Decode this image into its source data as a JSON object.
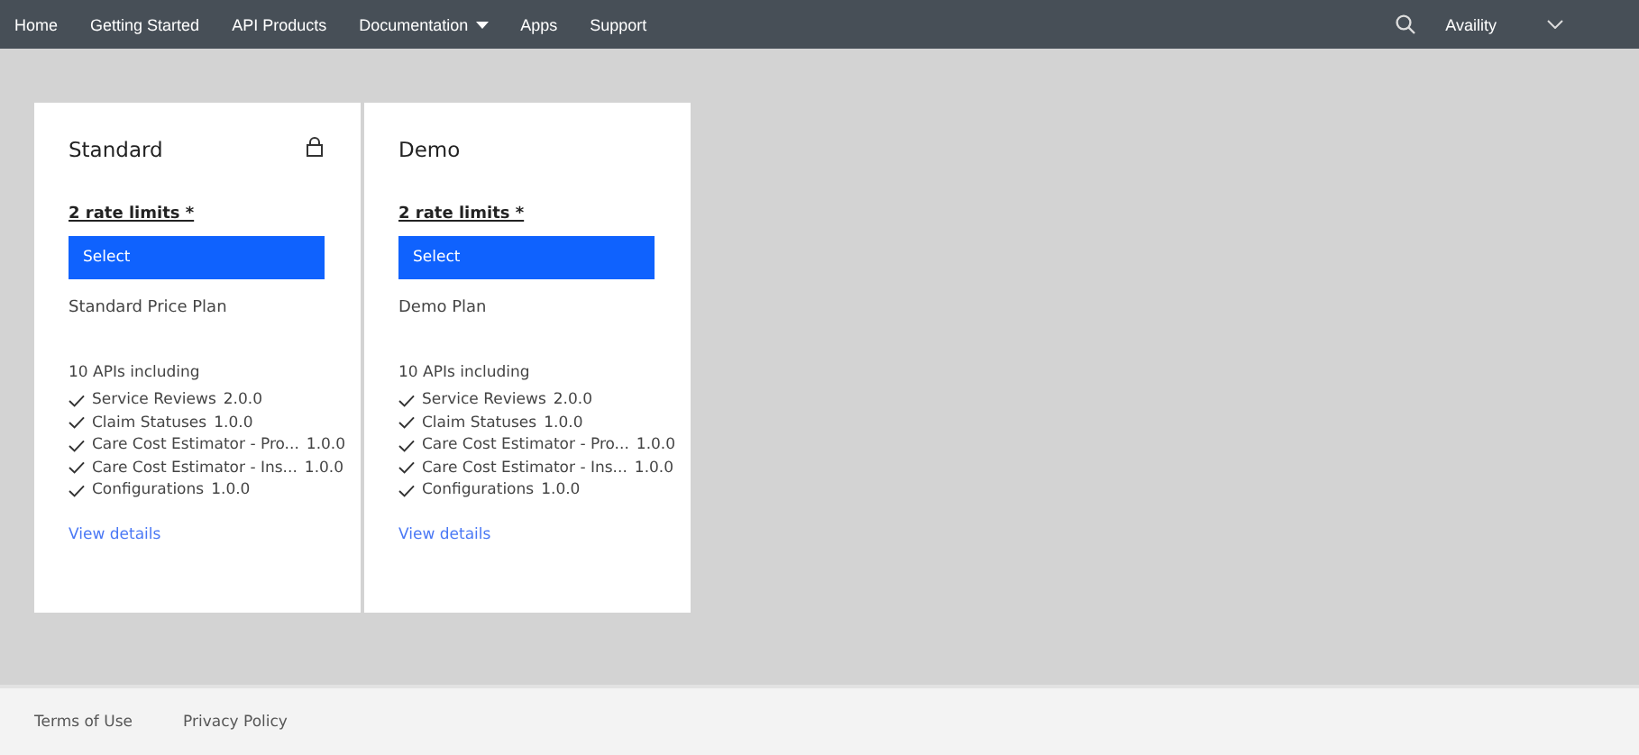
{
  "nav": {
    "items": [
      {
        "label": "Home",
        "dropdown": false
      },
      {
        "label": "Getting Started",
        "dropdown": false
      },
      {
        "label": "API Products",
        "dropdown": false
      },
      {
        "label": "Documentation",
        "dropdown": true
      },
      {
        "label": "Apps",
        "dropdown": false
      },
      {
        "label": "Support",
        "dropdown": false
      }
    ],
    "account": "Availity"
  },
  "plans": [
    {
      "title": "Standard",
      "locked": true,
      "rate_limits": "2 rate limits *",
      "button": "Select",
      "description": "Standard Price Plan",
      "apis_heading": "10 APIs including",
      "apis": [
        {
          "name": "Service Reviews",
          "version": "2.0.0"
        },
        {
          "name": "Claim Statuses",
          "version": "1.0.0"
        },
        {
          "name": "Care Cost Estimator - Pro...",
          "version": "1.0.0"
        },
        {
          "name": "Care Cost Estimator - Ins...",
          "version": "1.0.0"
        },
        {
          "name": "Configurations",
          "version": "1.0.0"
        }
      ],
      "link": "View details"
    },
    {
      "title": "Demo",
      "locked": false,
      "rate_limits": "2 rate limits *",
      "button": "Select",
      "description": "Demo Plan",
      "apis_heading": "10 APIs including",
      "apis": [
        {
          "name": "Service Reviews",
          "version": "2.0.0"
        },
        {
          "name": "Claim Statuses",
          "version": "1.0.0"
        },
        {
          "name": "Care Cost Estimator - Pro...",
          "version": "1.0.0"
        },
        {
          "name": "Care Cost Estimator - Ins...",
          "version": "1.0.0"
        },
        {
          "name": "Configurations",
          "version": "1.0.0"
        }
      ],
      "link": "View details"
    }
  ],
  "footer": {
    "links": [
      "Terms of Use",
      "Privacy Policy"
    ]
  }
}
